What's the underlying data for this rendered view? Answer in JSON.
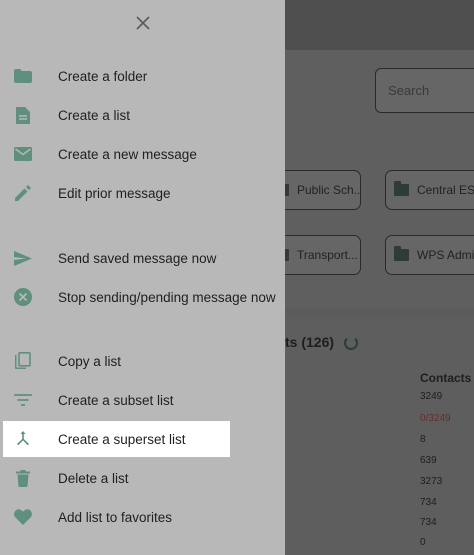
{
  "background": {
    "search": {
      "placeholder": "Search"
    },
    "group_cards": [
      {
        "label": "Public Sch..."
      },
      {
        "label": "Central ES"
      },
      {
        "label": "Transport..."
      },
      {
        "label": "WPS Admin"
      }
    ],
    "lists_title": "ts (126)",
    "contacts_header": "Contacts",
    "contacts": [
      "3249",
      "0/3249",
      "8",
      "639",
      "3273",
      "734",
      "734",
      "0"
    ]
  },
  "drawer": {
    "close_icon": "close-icon",
    "items": [
      {
        "label": "Create a folder",
        "icon": "folder-icon"
      },
      {
        "label": "Create a list",
        "icon": "document-icon"
      },
      {
        "label": "Create a new message",
        "icon": "email-icon"
      },
      {
        "label": "Edit prior message",
        "icon": "pencil-icon"
      },
      {
        "label": "Send saved message now",
        "icon": "send-icon"
      },
      {
        "label": "Stop sending/pending message now",
        "icon": "cancel-icon"
      },
      {
        "label": "Copy a list",
        "icon": "copy-icon"
      },
      {
        "label": "Create a subset list",
        "icon": "filter-icon"
      },
      {
        "label": "Create a superset list",
        "icon": "merge-icon"
      },
      {
        "label": "Delete a list",
        "icon": "trash-icon"
      },
      {
        "label": "Add list to favorites",
        "icon": "heart-icon"
      }
    ]
  },
  "colors": {
    "icon": "#5f8f7d",
    "drawer_bg": "#b8b8b8",
    "highlight_bg": "#ffffff"
  }
}
